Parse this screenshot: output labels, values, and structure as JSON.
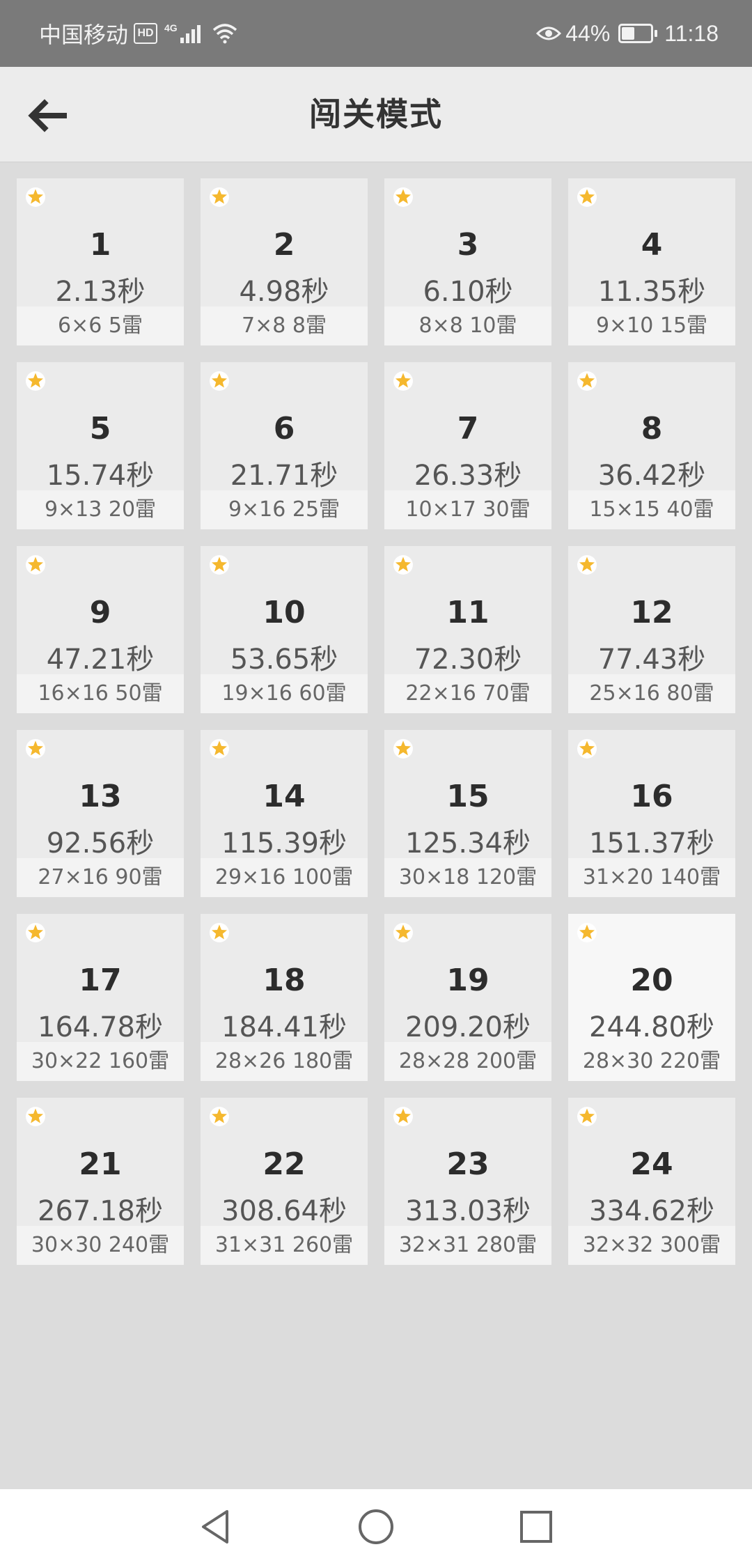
{
  "status_bar": {
    "carrier": "中国移动",
    "hd_badge": "HD",
    "network": "4G",
    "battery_percent": "44%",
    "battery_level": 0.44,
    "time": "11:18"
  },
  "header": {
    "title": "闯关模式"
  },
  "colors": {
    "star": "#F5B82E",
    "card_bg": "#EBEBEB",
    "selected_card_bg": "#F7F7F7"
  },
  "levels": [
    {
      "number": "1",
      "time": "2.13秒",
      "info": "6×6  5雷"
    },
    {
      "number": "2",
      "time": "4.98秒",
      "info": "7×8  8雷"
    },
    {
      "number": "3",
      "time": "6.10秒",
      "info": "8×8  10雷"
    },
    {
      "number": "4",
      "time": "11.35秒",
      "info": "9×10  15雷"
    },
    {
      "number": "5",
      "time": "15.74秒",
      "info": "9×13  20雷"
    },
    {
      "number": "6",
      "time": "21.71秒",
      "info": "9×16  25雷"
    },
    {
      "number": "7",
      "time": "26.33秒",
      "info": "10×17  30雷"
    },
    {
      "number": "8",
      "time": "36.42秒",
      "info": "15×15  40雷"
    },
    {
      "number": "9",
      "time": "47.21秒",
      "info": "16×16  50雷"
    },
    {
      "number": "10",
      "time": "53.65秒",
      "info": "19×16  60雷"
    },
    {
      "number": "11",
      "time": "72.30秒",
      "info": "22×16  70雷"
    },
    {
      "number": "12",
      "time": "77.43秒",
      "info": "25×16  80雷"
    },
    {
      "number": "13",
      "time": "92.56秒",
      "info": "27×16  90雷"
    },
    {
      "number": "14",
      "time": "115.39秒",
      "info": "29×16  100雷"
    },
    {
      "number": "15",
      "time": "125.34秒",
      "info": "30×18  120雷"
    },
    {
      "number": "16",
      "time": "151.37秒",
      "info": "31×20  140雷"
    },
    {
      "number": "17",
      "time": "164.78秒",
      "info": "30×22  160雷"
    },
    {
      "number": "18",
      "time": "184.41秒",
      "info": "28×26  180雷"
    },
    {
      "number": "19",
      "time": "209.20秒",
      "info": "28×28  200雷"
    },
    {
      "number": "20",
      "time": "244.80秒",
      "info": "28×30  220雷"
    },
    {
      "number": "21",
      "time": "267.18秒",
      "info": "30×30  240雷"
    },
    {
      "number": "22",
      "time": "308.64秒",
      "info": "31×31  260雷"
    },
    {
      "number": "23",
      "time": "313.03秒",
      "info": "32×31  280雷"
    },
    {
      "number": "24",
      "time": "334.62秒",
      "info": "32×32  300雷"
    }
  ]
}
